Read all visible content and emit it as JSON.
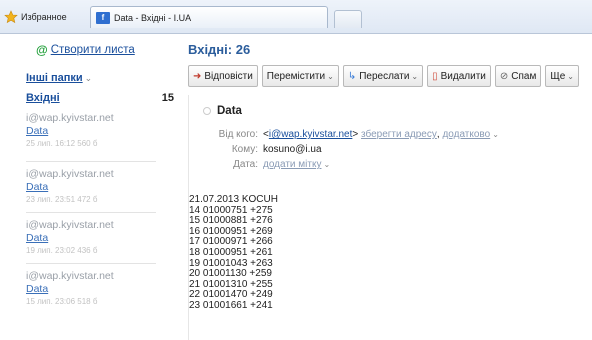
{
  "browser": {
    "favorites_label": "Избранное",
    "tab_title": "Data - Вхідні - I.UA",
    "tab_favicon": "f"
  },
  "sidebar": {
    "compose_at": "@",
    "compose_label": "Створити листа",
    "other_folders": "Інші папки",
    "inbox_label": "Вхідні",
    "inbox_count": "15",
    "messages": [
      {
        "sender": "i@wap.kyivstar.net",
        "subject": "Data",
        "date": "25 лип. 16:12 560 б"
      },
      {
        "sender": "i@wap.kyivstar.net",
        "subject": "Data",
        "date": "23 лип. 23:51 472 б"
      },
      {
        "sender": "i@wap.kyivstar.net",
        "subject": "Data",
        "date": "19 лип. 23:02 436 б"
      },
      {
        "sender": "i@wap.kyivstar.net",
        "subject": "Data",
        "date": "15 лип. 23:06 518 б"
      }
    ]
  },
  "main": {
    "title": "Вхідні: 26",
    "toolbar": {
      "reply": "Відповісти",
      "move": "Перемістити",
      "forward": "Переслати",
      "delete": "Видалити",
      "spam": "Спам",
      "more": "Ще"
    },
    "message": {
      "subject": "Data",
      "from_label": "Від кого:",
      "from_lt": "<",
      "from_email": "i@wap.kyivstar.net",
      "from_gt": ">",
      "save_address": "зберегти адресу",
      "comma": ",",
      "more_link": "додатково",
      "to_label": "Кому:",
      "to_value": "kosuno@i.ua",
      "date_label": "Дата:",
      "add_tag": "додати мітку",
      "body": [
        "21.07.2013 KOCUH",
        "14 01000751 +275",
        "15 01000881 +276",
        "16 01000951 +269",
        "17 01000971 +266",
        "18 01000951 +261",
        "19 01001043 +263",
        "20 01001130 +259",
        "21 01001310 +255",
        "22 01001470 +249",
        "23 01001661 +241"
      ]
    }
  }
}
